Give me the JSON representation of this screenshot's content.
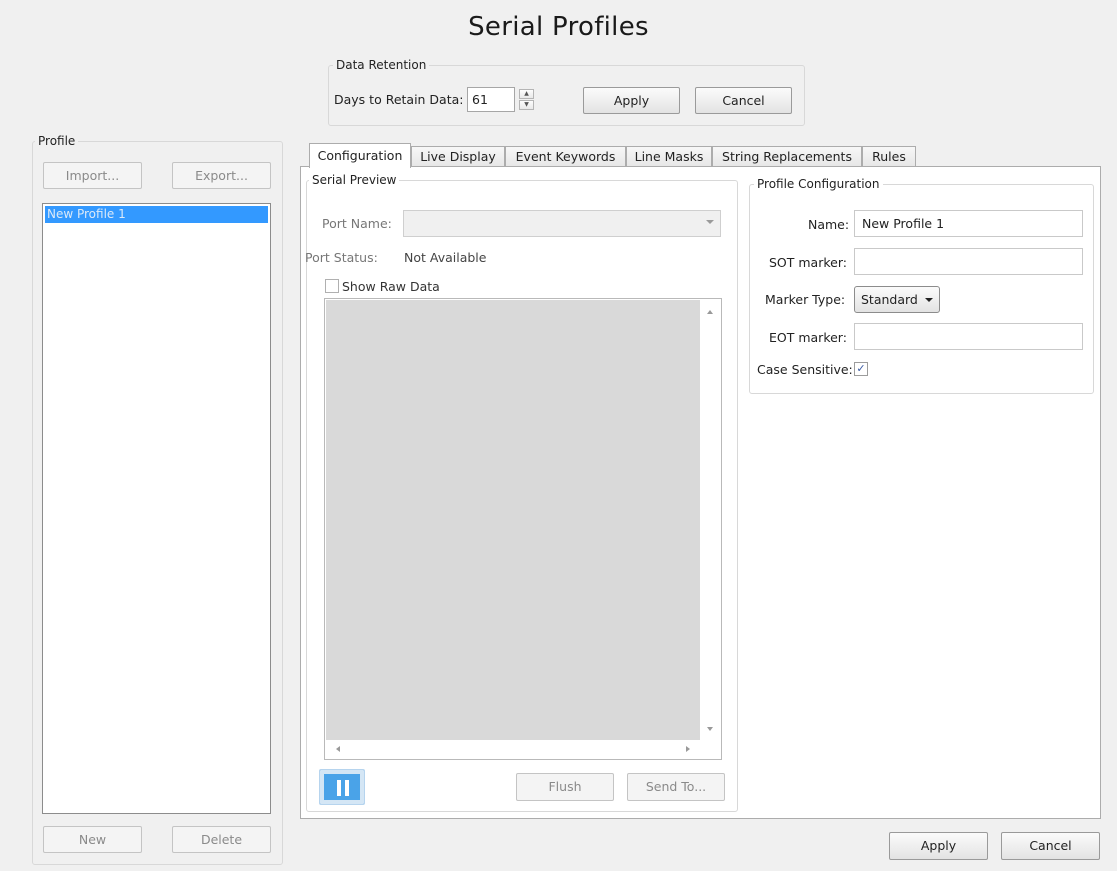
{
  "page": {
    "title": "Serial Profiles"
  },
  "data_retention": {
    "legend": "Data Retention",
    "days_label": "Days to Retain Data:",
    "days_value": "61",
    "apply_label": "Apply",
    "cancel_label": "Cancel"
  },
  "profile_panel": {
    "legend": "Profile",
    "import_label": "Import...",
    "export_label": "Export...",
    "items": [
      "New Profile 1"
    ],
    "new_label": "New",
    "delete_label": "Delete"
  },
  "tabs": [
    {
      "label": "Configuration",
      "active": true
    },
    {
      "label": "Live Display"
    },
    {
      "label": "Event Keywords"
    },
    {
      "label": "Line Masks"
    },
    {
      "label": "String Replacements"
    },
    {
      "label": "Rules"
    }
  ],
  "serial_preview": {
    "legend": "Serial Preview",
    "port_name_label": "Port Name:",
    "port_name_value": "",
    "port_status_label": "Port Status:",
    "port_status_value": "Not Available",
    "show_raw_label": "Show Raw Data",
    "show_raw_checked": false,
    "flush_label": "Flush",
    "send_to_label": "Send To..."
  },
  "profile_config": {
    "legend": "Profile Configuration",
    "name_label": "Name:",
    "name_value": "New Profile 1",
    "sot_label": "SOT marker:",
    "sot_value": "",
    "marker_type_label": "Marker Type:",
    "marker_type_value": "Standard",
    "eot_label": "EOT marker:",
    "eot_value": "",
    "case_sensitive_label": "Case Sensitive:",
    "case_sensitive_checked": true
  },
  "footer": {
    "apply_label": "Apply",
    "cancel_label": "Cancel"
  },
  "colors": {
    "selection": "#3399ff",
    "pause_button": "#4aa3e8",
    "background": "#f0f0f0"
  }
}
